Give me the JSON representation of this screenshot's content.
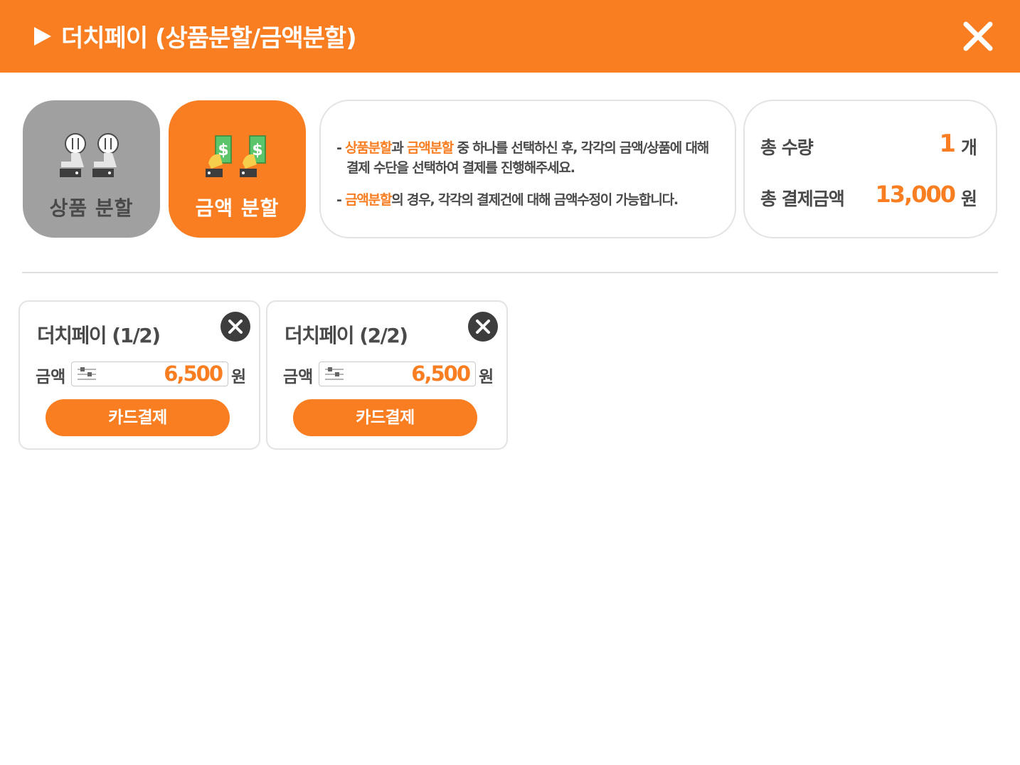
{
  "header": {
    "title": "더치페이 (상품분할/금액분할)"
  },
  "modes": {
    "product_split": {
      "label": "상품 분할",
      "selected": false
    },
    "amount_split": {
      "label": "금액 분할",
      "selected": true
    }
  },
  "info": {
    "line1_prefix": "- ",
    "line1_hl1": "상품분할",
    "line1_mid": "과 ",
    "line1_hl2": "금액분할",
    "line1_rest": " 중 하나를 선택하신 후, 각각의 금액/상품에 대해",
    "line2": "결제 수단을 선택하여 결제를 진행해주세요.",
    "line3_prefix": "- ",
    "line3_hl": "금액분할",
    "line3_rest": "의 경우, 각각의 결제건에 대해 금액수정이 가능합니다."
  },
  "summary": {
    "qty_label": "총 수량",
    "qty_value": "1",
    "qty_unit": "개",
    "total_label": "총 결제금액",
    "total_value": "13,000",
    "total_unit": "원"
  },
  "splits": [
    {
      "title": "더치페이 (1/2)",
      "amount_label": "금액",
      "amount": "6,500",
      "unit": "원",
      "pay_label": "카드결제"
    },
    {
      "title": "더치페이 (2/2)",
      "amount_label": "금액",
      "amount": "6,500",
      "unit": "원",
      "pay_label": "카드결제"
    }
  ],
  "colors": {
    "accent": "#f97e22",
    "inactive": "#a0a0a0",
    "text": "#4a4a4a",
    "dark_icon": "#3d3d3d"
  }
}
